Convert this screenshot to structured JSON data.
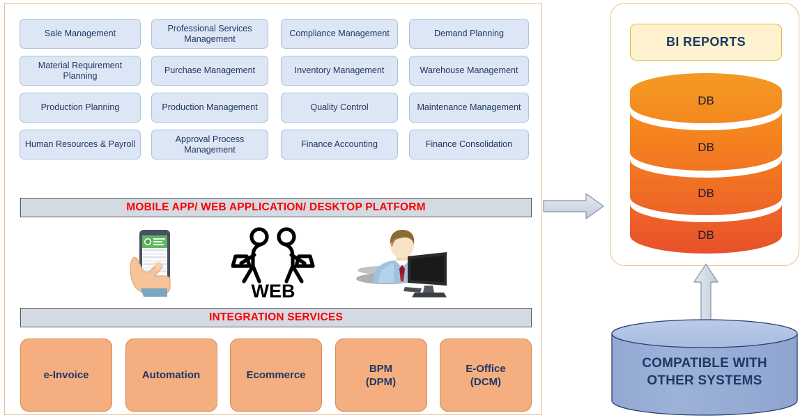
{
  "diagram": {
    "left_panel": {
      "modules": [
        {
          "label": "Sale Management"
        },
        {
          "label": "Professional Services Management"
        },
        {
          "label": "Compliance Management"
        },
        {
          "label": "Demand Planning"
        },
        {
          "label": "Material Requirement Planning"
        },
        {
          "label": "Purchase Management"
        },
        {
          "label": "Inventory Management"
        },
        {
          "label": "Warehouse Management"
        },
        {
          "label": "Production Planning"
        },
        {
          "label": "Production Management"
        },
        {
          "label": "Quality Control"
        },
        {
          "label": "Maintenance Management"
        },
        {
          "label": "Human Resources & Payroll"
        },
        {
          "label": "Approval Process Management"
        },
        {
          "label": "Finance Accounting"
        },
        {
          "label": "Finance Consolidation"
        }
      ],
      "platform_banner": "MOBILE APP/ WEB APPLICATION/ DESKTOP PLATFORM",
      "integration_banner": "INTEGRATION SERVICES",
      "channel_icons": [
        {
          "name": "mobile-phone-in-hand-icon",
          "caption": ""
        },
        {
          "name": "web-people-icon",
          "caption": "WEB"
        },
        {
          "name": "desktop-user-icon",
          "caption": ""
        }
      ],
      "service_cards": [
        {
          "label": "e-Invoice"
        },
        {
          "label": "Automation"
        },
        {
          "label": "Ecommerce"
        },
        {
          "label": "BPM\n(DPM)",
          "line1": "BPM",
          "line2": "(DPM)"
        },
        {
          "label": "E-Office\n(DCM)",
          "line1": "E-Office",
          "line2": "(DCM)"
        }
      ]
    },
    "right_panel": {
      "bi_reports_label": "BI REPORTS",
      "db_layers": [
        {
          "label": "DB"
        },
        {
          "label": "DB"
        },
        {
          "label": "DB"
        },
        {
          "label": "DB"
        }
      ]
    },
    "compatible_cylinder": {
      "line1": "COMPATIBLE WITH",
      "line2": "OTHER SYSTEMS"
    },
    "arrows": [
      {
        "name": "arrow-left-to-right",
        "direction": "right"
      },
      {
        "name": "arrow-bottom-to-top",
        "direction": "up"
      }
    ],
    "colors": {
      "module_fill": "#dce6f4",
      "module_border": "#a9c3e0",
      "module_text": "#1f3864",
      "banner_fill": "#d4dae1",
      "banner_text": "#ff0000",
      "service_card_fill": "#f4ae7f",
      "service_card_border": "#d98b52",
      "panel_border": "#e8bd8e",
      "bi_fill": "#fdf2cd",
      "bi_border": "#e0b94b",
      "db_top": "#f2921d",
      "db_bottom": "#e8542a",
      "cylinder_fill": "#92a8d4",
      "cylinder_top": "#b0c2e4",
      "arrow_fill": "#d5dce6",
      "arrow_border": "#7f94b5"
    }
  }
}
